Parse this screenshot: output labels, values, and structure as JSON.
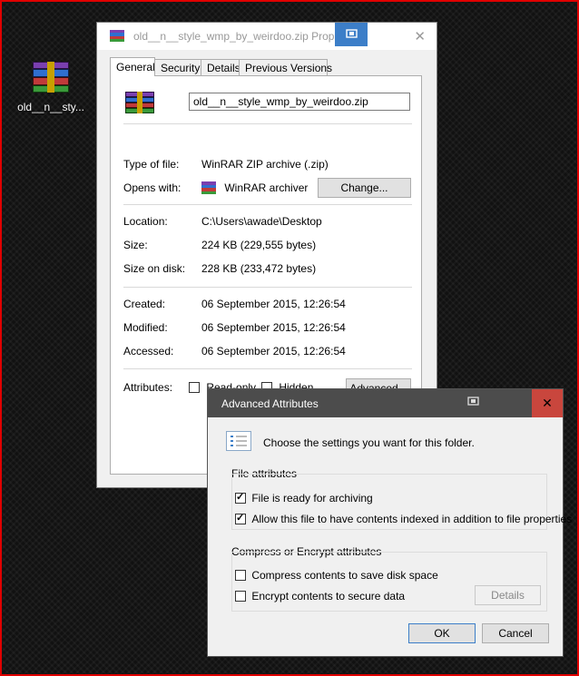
{
  "desktop": {
    "icon_label": "old__n__sty...",
    "icon_name": "winrar-archive-icon",
    "border_color": "#e00000"
  },
  "properties": {
    "title": "old__n__style_wmp_by_weirdoo.zip Prope",
    "close_label": "✕",
    "tabs": [
      "General",
      "Security",
      "Details",
      "Previous Versions"
    ],
    "active_tab": "General",
    "file_name": "old__n__style_wmp_by_weirdoo.zip",
    "type_label": "Type of file:",
    "type_value": "WinRAR ZIP archive (.zip)",
    "opens_label": "Opens with:",
    "opens_value": "WinRAR archiver",
    "change_button": "Change...",
    "location_label": "Location:",
    "location_value": "C:\\Users\\awade\\Desktop",
    "size_label": "Size:",
    "size_value": "224 KB (229,555 bytes)",
    "size_disk_label": "Size on disk:",
    "size_disk_value": "228 KB (233,472 bytes)",
    "created_label": "Created:",
    "created_value": "06 September 2015, 12:26:54",
    "modified_label": "Modified:",
    "modified_value": "06 September 2015, 12:26:54",
    "accessed_label": "Accessed:",
    "accessed_value": "06 September 2015, 12:26:54",
    "attributes_label": "Attributes:",
    "readonly_label": "Read-only",
    "hidden_label": "Hidden",
    "advanced_button": "Advanced..."
  },
  "advanced": {
    "title": "Advanced Attributes",
    "close_label": "✕",
    "intro": "Choose the settings you want for this folder.",
    "file_attributes_label": "File attributes",
    "archive_label": "File is ready for archiving",
    "archive_checked": true,
    "index_label": "Allow this file to have contents indexed in addition to file properties",
    "index_checked": true,
    "compress_group_label": "Compress or Encrypt attributes",
    "compress_label": "Compress contents to save disk space",
    "compress_checked": false,
    "encrypt_label": "Encrypt contents to secure data",
    "encrypt_checked": false,
    "details_button": "Details",
    "ok_button": "OK",
    "cancel_button": "Cancel",
    "accent_color": "#3c7ec8",
    "close_color": "#c9463d"
  }
}
